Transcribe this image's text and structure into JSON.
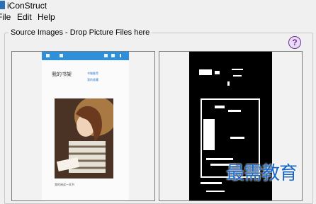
{
  "window": {
    "title": "iConStruct"
  },
  "menu": [
    {
      "label": "File"
    },
    {
      "label": "Edit"
    },
    {
      "label": "Help"
    }
  ],
  "group": {
    "label": "Source Images - Drop Picture Files here"
  },
  "help_button": {
    "label": "?"
  },
  "phone": {
    "heading": "我的书架",
    "side_items": [
      "书城推荐",
      "我的收藏"
    ],
    "caption": "我的阅读一本书"
  },
  "watermark": {
    "text": "最需教育"
  },
  "colors": {
    "accent": "#2f8fd8",
    "help_purple": "#6b2f99",
    "watermark_blue": "#1866c7"
  }
}
